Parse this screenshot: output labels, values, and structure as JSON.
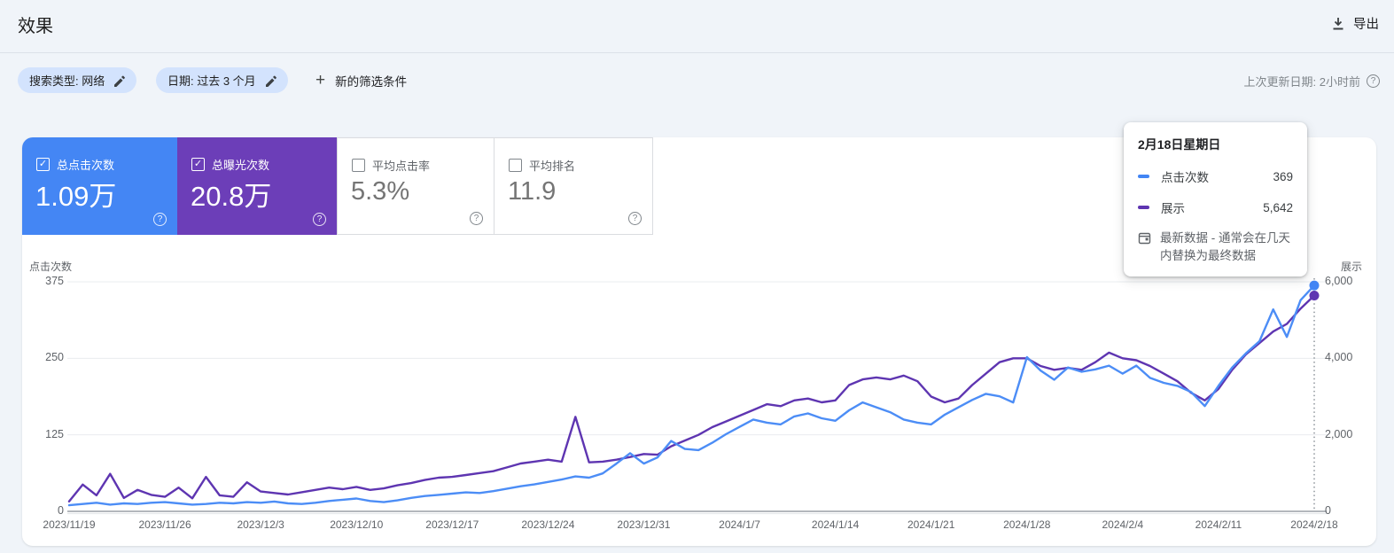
{
  "header": {
    "title": "效果",
    "export_label": "导出",
    "last_updated": "上次更新日期: 2小时前"
  },
  "filters": {
    "search_type_chip": "搜索类型: 网络",
    "date_chip": "日期: 过去 3 个月",
    "add_filter_label": "新的筛选条件"
  },
  "icons": {
    "check": "✓",
    "plus": "+",
    "help": "?"
  },
  "cards": [
    {
      "label": "总点击次数",
      "value": "1.09万",
      "selected": true,
      "color": "#4486f4"
    },
    {
      "label": "总曝光次数",
      "value": "20.8万",
      "selected": true,
      "color": "#6c3eb8"
    },
    {
      "label": "平均点击率",
      "value": "5.3%",
      "selected": false,
      "color": "#ffffff"
    },
    {
      "label": "平均排名",
      "value": "11.9",
      "selected": false,
      "color": "#ffffff"
    }
  ],
  "tooltip": {
    "title": "2月18日星期日",
    "rows": [
      {
        "label": "点击次数",
        "value": "369",
        "color": "#4285f4"
      },
      {
        "label": "展示",
        "value": "5,642",
        "color": "#5e35b1"
      }
    ],
    "note": "最新数据 - 通常会在几天内替换为最终数据"
  },
  "chart_data": {
    "type": "line",
    "x_tick_labels": [
      "2023/11/19",
      "2023/11/26",
      "2023/12/3",
      "2023/12/10",
      "2023/12/17",
      "2023/12/24",
      "2023/12/31",
      "2024/1/7",
      "2024/1/14",
      "2024/1/21",
      "2024/1/28",
      "2024/2/4",
      "2024/2/11",
      "2024/2/18"
    ],
    "x_tick_days": [
      0,
      7,
      14,
      21,
      28,
      35,
      42,
      49,
      56,
      63,
      70,
      77,
      84,
      91
    ],
    "left_axis": {
      "title": "点击次数",
      "max": 375,
      "ticks": [
        {
          "value": 375,
          "label": "375"
        },
        {
          "value": 250,
          "label": "250"
        },
        {
          "value": 125,
          "label": "125"
        },
        {
          "value": 0,
          "label": "0"
        }
      ]
    },
    "right_axis": {
      "title": "展示",
      "max": 6000,
      "ticks": [
        {
          "value": 6000,
          "label": "6,000"
        },
        {
          "value": 4000,
          "label": "4,000"
        },
        {
          "value": 2000,
          "label": "2,000"
        },
        {
          "value": 0,
          "label": "0"
        }
      ]
    },
    "grid": true,
    "legend_position": "tooltip",
    "series": [
      {
        "name": "点击次数",
        "axis": "left",
        "color": "#4c8df6",
        "values": [
          10,
          12,
          14,
          11,
          13,
          12,
          14,
          15,
          13,
          11,
          12,
          14,
          13,
          15,
          14,
          16,
          13,
          12,
          14,
          17,
          19,
          21,
          17,
          15,
          18,
          22,
          25,
          27,
          29,
          31,
          30,
          33,
          37,
          41,
          44,
          48,
          52,
          57,
          55,
          62,
          78,
          95,
          78,
          88,
          115,
          102,
          100,
          112,
          126,
          138,
          150,
          145,
          142,
          155,
          160,
          152,
          148,
          165,
          178,
          170,
          162,
          150,
          145,
          142,
          158,
          170,
          182,
          192,
          188,
          178,
          252,
          230,
          215,
          235,
          228,
          232,
          238,
          225,
          238,
          218,
          210,
          205,
          195,
          172,
          205,
          235,
          258,
          278,
          330,
          285,
          345,
          369
        ]
      },
      {
        "name": "展示",
        "axis": "right",
        "color": "#5e35b1",
        "values": [
          260,
          700,
          420,
          980,
          350,
          560,
          430,
          380,
          620,
          340,
          900,
          420,
          380,
          760,
          520,
          480,
          440,
          500,
          560,
          620,
          580,
          640,
          560,
          600,
          680,
          740,
          820,
          880,
          900,
          950,
          1000,
          1050,
          1150,
          1250,
          1300,
          1350,
          1300,
          2470,
          1280,
          1300,
          1350,
          1420,
          1500,
          1480,
          1700,
          1850,
          2000,
          2200,
          2350,
          2500,
          2650,
          2800,
          2750,
          2900,
          2950,
          2850,
          2900,
          3300,
          3450,
          3500,
          3450,
          3550,
          3400,
          3000,
          2850,
          2950,
          3300,
          3600,
          3900,
          4000,
          4000,
          3800,
          3700,
          3750,
          3700,
          3900,
          4150,
          4000,
          3950,
          3800,
          3600,
          3400,
          3100,
          2900,
          3200,
          3700,
          4100,
          4400,
          4700,
          4900,
          5300,
          5642
        ]
      }
    ],
    "hovered_point": {
      "date": "2024/2/18",
      "clicks": 369,
      "impressions": 5642
    }
  }
}
